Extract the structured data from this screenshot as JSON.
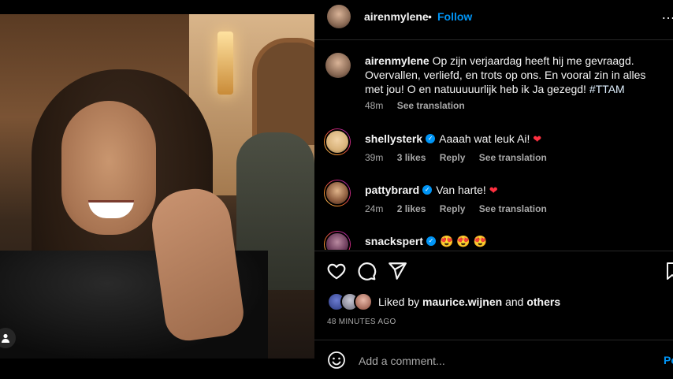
{
  "post": {
    "username": "airenmylene",
    "separator": "•",
    "follow_label": "Follow",
    "more_label": "…"
  },
  "caption": {
    "username": "airenmylene",
    "text": "Op zijn verjaardag heeft hij me gevraagd. Overvallen, verliefd, en trots op ons. En vooral zin in alles met jou! O en natuuuuurlijk heb ik Ja gezegd!",
    "hashtag": "#TTAM",
    "time": "48m",
    "see_translation": "See translation"
  },
  "comments": [
    {
      "username": "shellysterk",
      "verified": true,
      "text": "Aaaah wat leuk Ai!",
      "emoji": "❤",
      "time": "39m",
      "likes": "3 likes",
      "reply": "Reply",
      "see_translation": "See translation",
      "avatar_color": "#d8b27a"
    },
    {
      "username": "pattybrard",
      "verified": true,
      "text": "Van harte!",
      "emoji": "❤",
      "time": "24m",
      "likes": "2 likes",
      "reply": "Reply",
      "see_translation": "See translation",
      "avatar_color": "#8b5a3c"
    },
    {
      "username": "snackspert",
      "verified": true,
      "text": "😍 😍 😍",
      "avatar_color": "#6b3a5a"
    }
  ],
  "actions": {
    "liked_by_prefix": "Liked by",
    "liked_by_user": "maurice.wijnen",
    "liked_by_and": "and",
    "liked_by_others": "others",
    "time_ago": "48 MINUTES AGO"
  },
  "composer": {
    "placeholder": "Add a comment...",
    "post_label": "Post"
  },
  "colors": {
    "link": "#0095f6",
    "text": "#f5f5f5",
    "muted": "#a8a8a8",
    "heart": "#ff3040",
    "background": "#000000"
  }
}
